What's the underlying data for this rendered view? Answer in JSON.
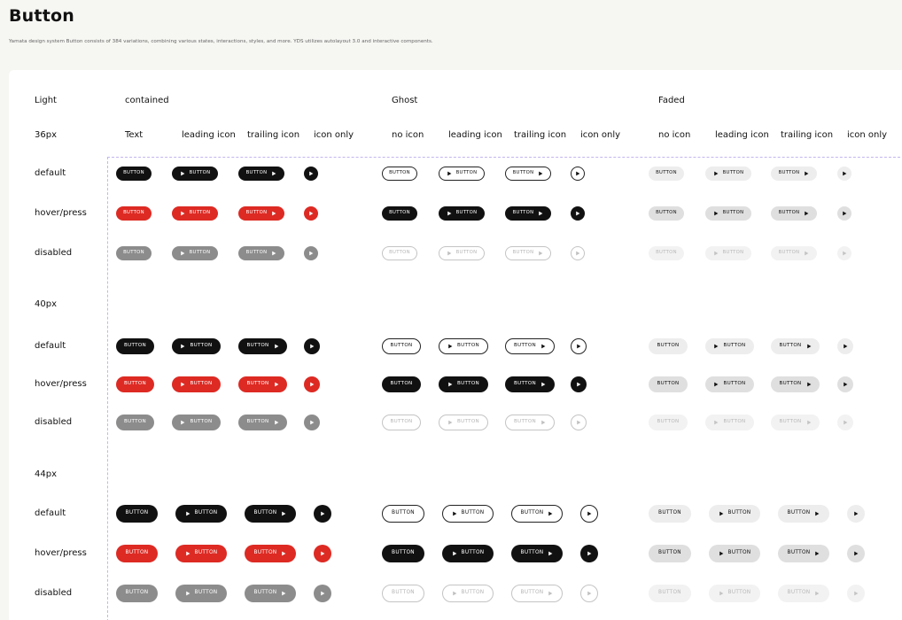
{
  "page": {
    "title": "Button",
    "subtitle": "Yamata design system Button consists of 384 variations, combining various states, interactions, styles, and more. YDS utilizes autolayout 3.0 and interactive components."
  },
  "theme": {
    "name": "Light"
  },
  "styles": [
    "contained",
    "Ghost",
    "Faded"
  ],
  "variants": [
    "Text",
    "leading icon",
    "trailing icon",
    "icon only",
    "no icon"
  ],
  "sizes": [
    "36px",
    "40px",
    "44px"
  ],
  "states": [
    "default",
    "hover/press",
    "disabled"
  ],
  "button": {
    "label": "BUTTON",
    "icon": "play-icon"
  },
  "colors": {
    "contained_default": "#111111",
    "contained_hover": "#dd2a23",
    "contained_disabled": "#8c8c8c",
    "ghost_border": "#222222",
    "ghost_hover": "#111111",
    "ghost_disabled": "#c4c4c4",
    "faded_bg": "#ededed",
    "faded_hover": "#dfdfdf",
    "faded_disabled": "#f2f2f2",
    "grid_dash": "#c3b6ef"
  }
}
